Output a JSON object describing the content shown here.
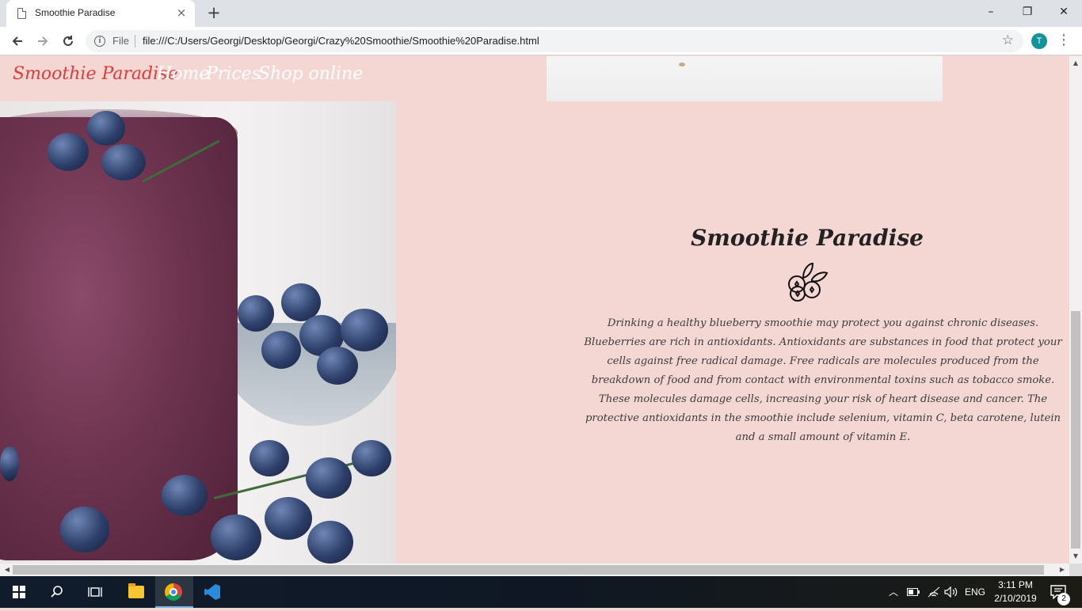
{
  "browser": {
    "tab_title": "Smoothie Paradise",
    "tab_close": "×",
    "new_tab": "+",
    "scheme_label": "File",
    "url": "file:///C:/Users/Georgi/Desktop/Georgi/Crazy%20Smoothie/Smoothie%20Paradise.html",
    "profile_initial": "T",
    "minimize": "–",
    "maximize": "❐",
    "close": "✕"
  },
  "page": {
    "brand": "Smoothie Paradise",
    "nav": [
      "Home",
      "Prices",
      "Shop online"
    ],
    "section_title": "Smoothie Paradise",
    "description": "Drinking a healthy blueberry smoothie may protect you against chronic diseases. Blueberries are rich in antioxidants. Antioxidants are substances in food that protect your cells against free radical damage. Free radicals are molecules produced from the breakdown of food and from contact with environmental toxins such as tobacco smoke. These molecules damage cells, increasing your risk of heart disease and cancer. The protective antioxidants in the smoothie include selenium, vitamin C, beta carotene, lutein and a small amount of vitamin E.",
    "icons": {
      "section": "blueberries-icon",
      "photo": "blueberry-smoothie-photo"
    }
  },
  "taskbar": {
    "language": "ENG",
    "time": "3:11 PM",
    "date": "2/10/2019",
    "notification_count": "2",
    "colors": {
      "accent": "#7fb2e5"
    }
  },
  "colors": {
    "page_background": "#f4d7d3",
    "brand": "#e03b3b",
    "nav_link": "#ffffff",
    "text": "#3c3c3c"
  }
}
